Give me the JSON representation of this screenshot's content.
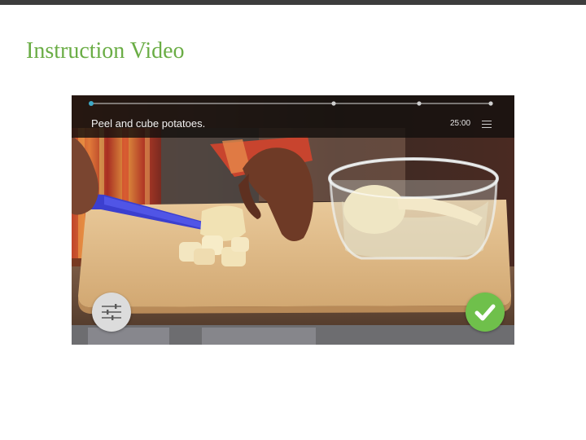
{
  "page": {
    "title": "Instruction Video"
  },
  "video": {
    "step_text": "Peel and cube potatoes.",
    "duration": "25:00",
    "progress": 0.0,
    "markers": [
      "step-marker",
      "step-marker",
      "step-marker",
      "step-marker"
    ]
  },
  "icons": {
    "menu": "menu-icon",
    "settings": "sliders-icon",
    "done": "checkmark-icon"
  },
  "colors": {
    "title": "#6aad45",
    "top_bar": "#3d3d3d",
    "done_button": "#6fc04b",
    "progress_marker": "#3fa9c7"
  }
}
